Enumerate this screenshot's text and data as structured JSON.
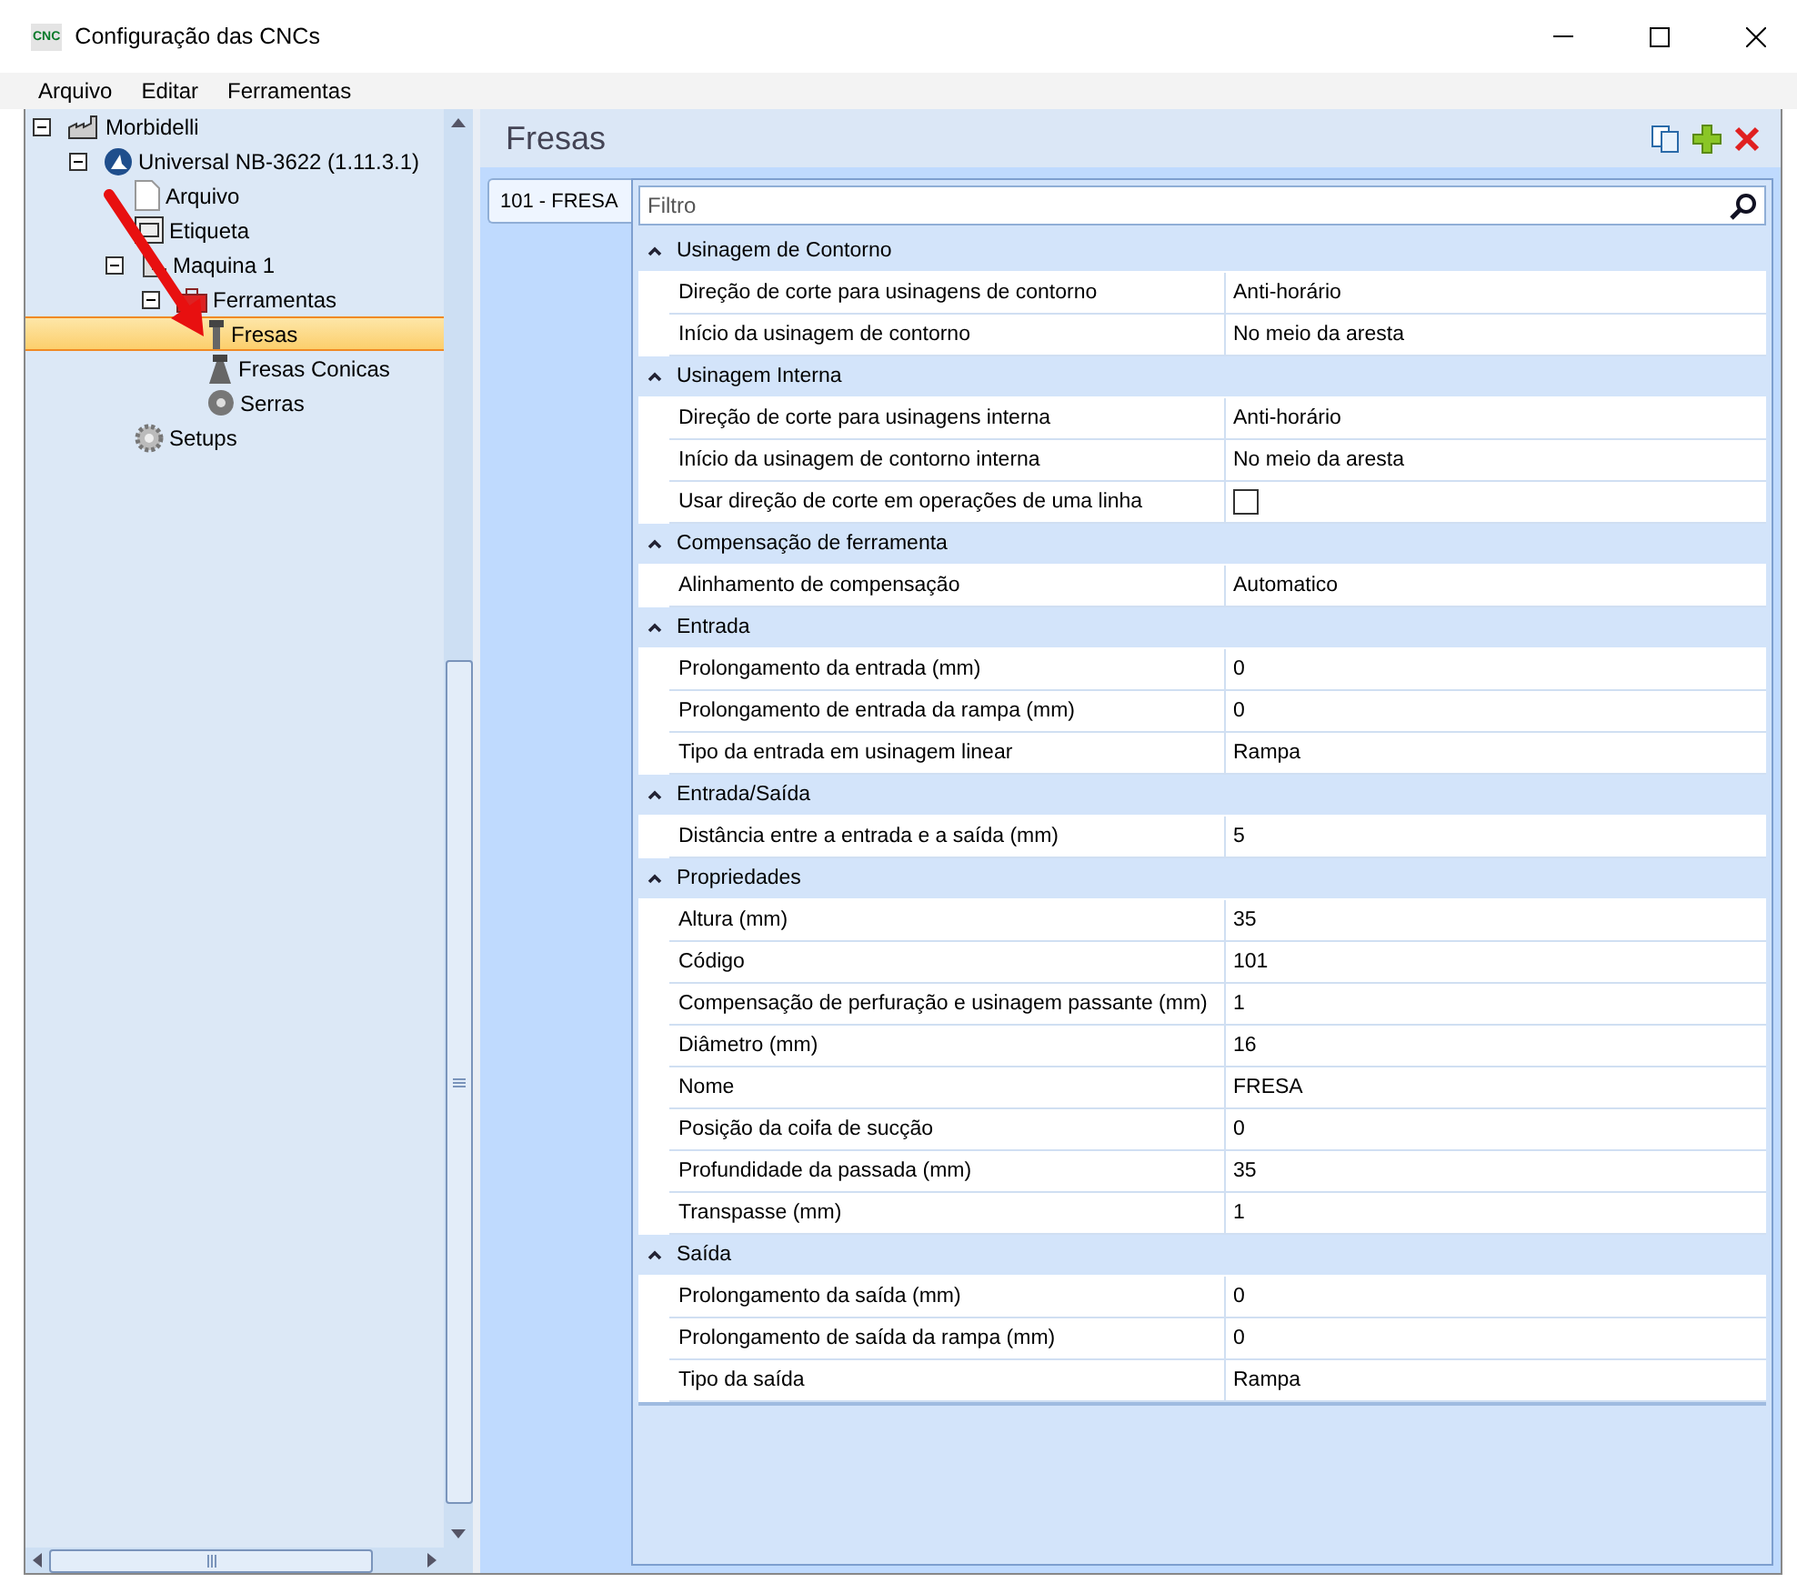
{
  "window": {
    "title": "Configuração das CNCs",
    "logo": "CNC"
  },
  "menu": [
    "Arquivo",
    "Editar",
    "Ferramentas"
  ],
  "tree": [
    {
      "label": "Morbidelli",
      "kind": "factory",
      "expanded": true,
      "selected": false,
      "children": [
        {
          "label": "Universal NB-3622 (1.11.3.1)",
          "kind": "machine-model",
          "expanded": true,
          "selected": false,
          "children": [
            {
              "label": "Arquivo",
              "kind": "file",
              "selected": false
            },
            {
              "label": "Etiqueta",
              "kind": "label",
              "selected": false
            },
            {
              "label": "Maquina 1",
              "kind": "machine",
              "expanded": true,
              "selected": false,
              "children": [
                {
                  "label": "Ferramentas",
                  "kind": "toolbox",
                  "expanded": true,
                  "selected": false,
                  "children": [
                    {
                      "label": "Fresas",
                      "kind": "mill",
                      "selected": true
                    },
                    {
                      "label": "Fresas Conicas",
                      "kind": "cone",
                      "selected": false
                    },
                    {
                      "label": "Serras",
                      "kind": "saw",
                      "selected": false
                    }
                  ]
                }
              ]
            },
            {
              "label": "Setups",
              "kind": "setup",
              "selected": false
            }
          ]
        }
      ]
    }
  ],
  "panel": {
    "title": "Fresas",
    "tabs": [
      {
        "label": "101 - FRESA",
        "selected": true
      }
    ],
    "filter": {
      "placeholder": "Filtro"
    }
  },
  "groups": [
    {
      "title": "Usinagem de Contorno",
      "expanded": true,
      "rows": [
        {
          "kind": "text",
          "name": "Direção de corte para usinagens de contorno",
          "value": "Anti-horário"
        },
        {
          "kind": "text",
          "name": "Início da usinagem de contorno",
          "value": "No meio da aresta"
        }
      ]
    },
    {
      "title": "Usinagem Interna",
      "expanded": true,
      "rows": [
        {
          "kind": "text",
          "name": "Direção de corte para usinagens interna",
          "value": "Anti-horário"
        },
        {
          "kind": "text",
          "name": "Início da usinagem de contorno interna",
          "value": "No meio da aresta"
        },
        {
          "kind": "checkbox",
          "name": "Usar direção de corte em operações de uma linha",
          "checked": false
        }
      ]
    },
    {
      "title": "Compensação de ferramenta",
      "expanded": true,
      "rows": [
        {
          "kind": "text",
          "name": "Alinhamento de compensação",
          "value": "Automatico"
        }
      ]
    },
    {
      "title": "Entrada",
      "expanded": true,
      "rows": [
        {
          "kind": "text",
          "name": "Prolongamento da entrada (mm)",
          "value": "0"
        },
        {
          "kind": "text",
          "name": "Prolongamento de entrada da rampa (mm)",
          "value": "0"
        },
        {
          "kind": "text",
          "name": "Tipo da entrada em usinagem linear",
          "value": "Rampa"
        }
      ]
    },
    {
      "title": "Entrada/Saída",
      "expanded": true,
      "rows": [
        {
          "kind": "text",
          "name": "Distância entre a entrada e a saída (mm)",
          "value": "5"
        }
      ]
    },
    {
      "title": "Propriedades",
      "expanded": true,
      "rows": [
        {
          "kind": "text",
          "name": "Altura (mm)",
          "value": "35"
        },
        {
          "kind": "text",
          "name": "Código",
          "value": "101"
        },
        {
          "kind": "text",
          "name": "Compensação de perfuração e usinagem passante (mm)",
          "value": "1"
        },
        {
          "kind": "text",
          "name": "Diâmetro (mm)",
          "value": "16"
        },
        {
          "kind": "text",
          "name": "Nome",
          "value": "FRESA"
        },
        {
          "kind": "text",
          "name": "Posição da coifa de sucção",
          "value": "0"
        },
        {
          "kind": "text",
          "name": "Profundidade da passada (mm)",
          "value": "35"
        },
        {
          "kind": "text",
          "name": "Transpasse (mm)",
          "value": "1"
        }
      ]
    },
    {
      "title": "Saída",
      "expanded": true,
      "rows": [
        {
          "kind": "text",
          "name": "Prolongamento da saída (mm)",
          "value": "0"
        },
        {
          "kind": "text",
          "name": "Prolongamento de saída da rampa (mm)",
          "value": "0"
        },
        {
          "kind": "text",
          "name": "Tipo da saída",
          "value": "Rampa"
        }
      ]
    }
  ]
}
